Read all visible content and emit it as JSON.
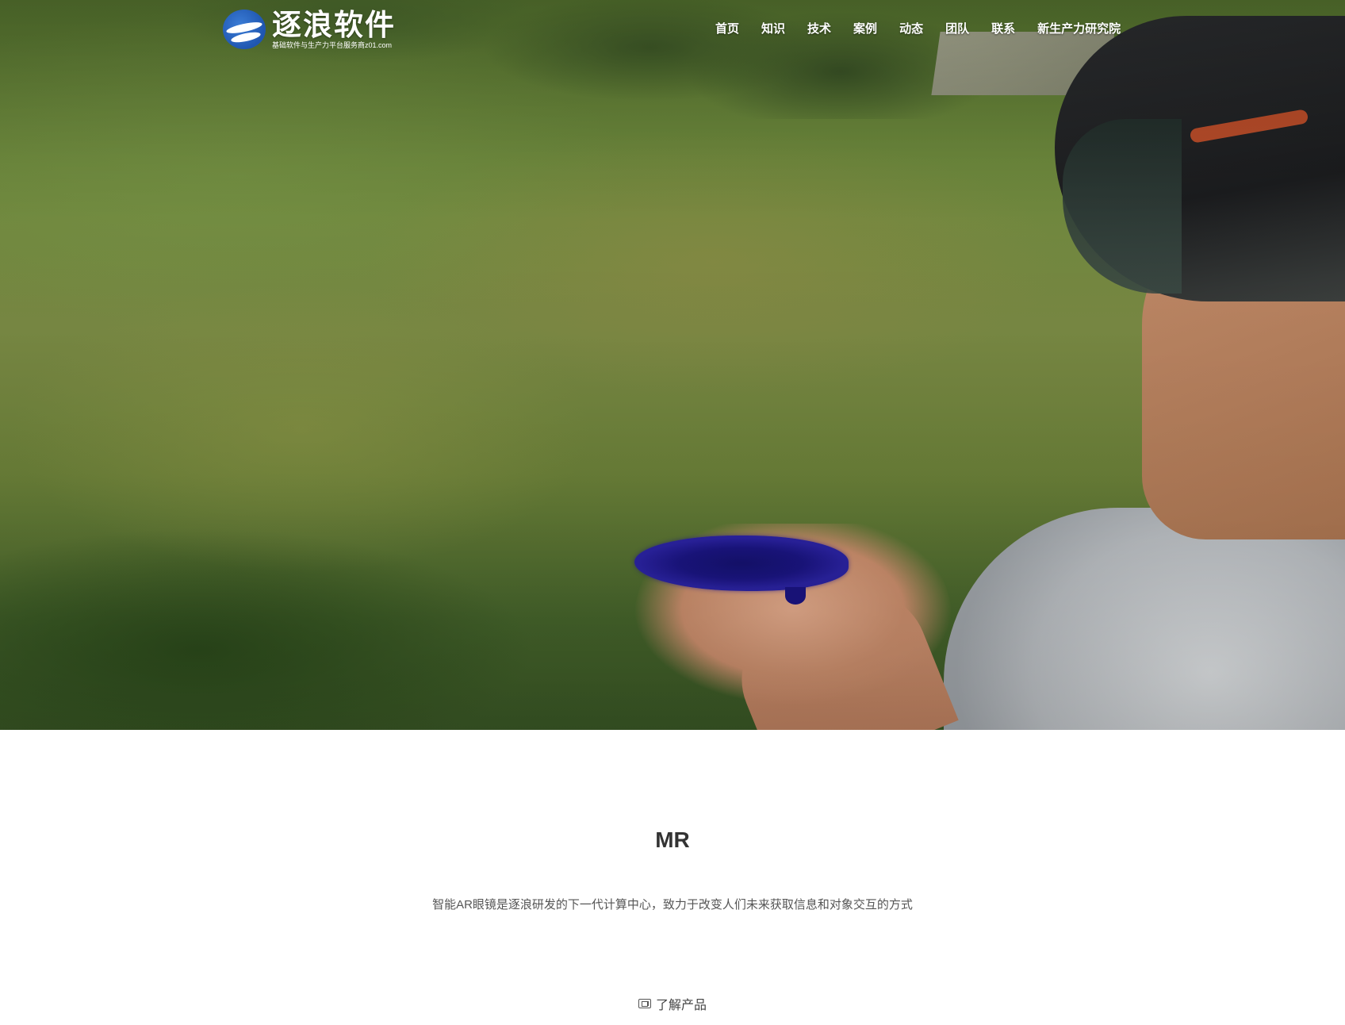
{
  "brand": {
    "name": "逐浪软件",
    "tagline": "基础软件与生产力平台服务商z01.com",
    "logo_icon": "wave-globe-icon"
  },
  "nav": {
    "items": [
      {
        "label": "首页"
      },
      {
        "label": "知识"
      },
      {
        "label": "技术"
      },
      {
        "label": "案例"
      },
      {
        "label": "动态"
      },
      {
        "label": "团队"
      },
      {
        "label": "联系"
      },
      {
        "label": "新生产力研究院"
      }
    ]
  },
  "section": {
    "title": "MR",
    "description": "智能AR眼镜是逐浪研发的下一代计算中心，致力于改变人们未来获取信息和对象交互的方式",
    "link_label": "了解产品",
    "link_icon": "book-icon"
  },
  "colors": {
    "nav_text": "#ffffff",
    "title": "#333333",
    "body_text": "#555555"
  }
}
